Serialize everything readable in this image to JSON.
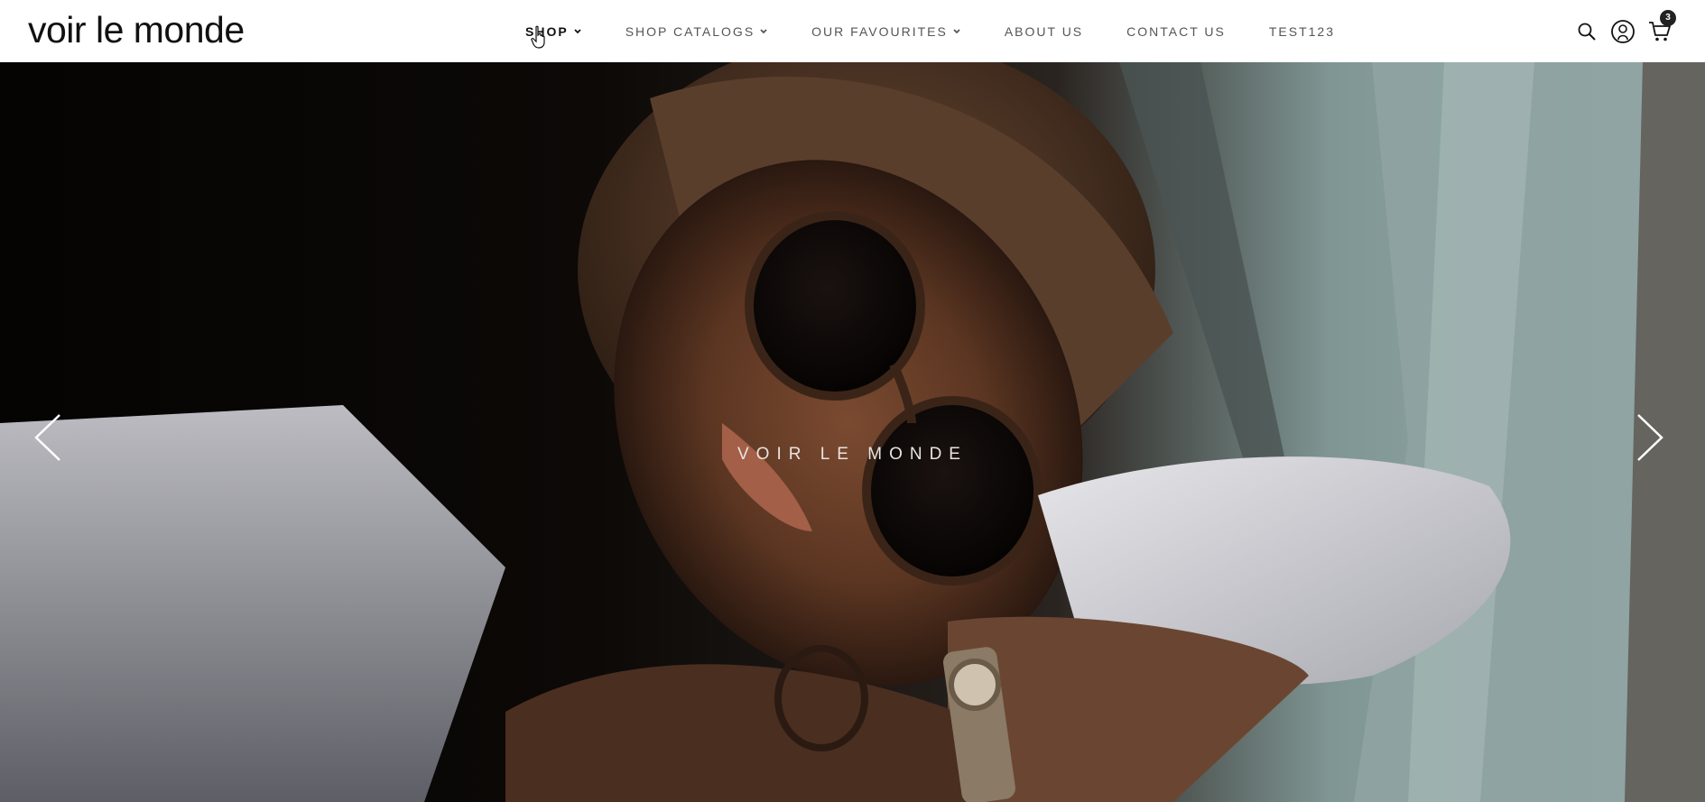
{
  "header": {
    "logo": "voir le monde",
    "nav": [
      {
        "label": "SHOP",
        "has_dropdown": true
      },
      {
        "label": "SHOP CATALOGS",
        "has_dropdown": true
      },
      {
        "label": "OUR FAVOURITES",
        "has_dropdown": true
      },
      {
        "label": "ABOUT US",
        "has_dropdown": false
      },
      {
        "label": "CONTACT US",
        "has_dropdown": false
      },
      {
        "label": "TEST123",
        "has_dropdown": false
      }
    ],
    "active_nav": "SHOP",
    "icons": [
      "search-icon",
      "account-icon",
      "cart-icon"
    ],
    "cart_count": "3"
  },
  "hero": {
    "title": "VOIR LE MONDE",
    "image": "woman-in-sunglasses-resting-on-car-window",
    "prev_icon": "chevron-left-icon",
    "next_icon": "chevron-right-icon"
  },
  "colors": {
    "header_bg": "#ffffff",
    "text": "#111111",
    "nav_text": "#555555",
    "badge_bg": "#222222",
    "hero_text": "#e8e4df"
  }
}
